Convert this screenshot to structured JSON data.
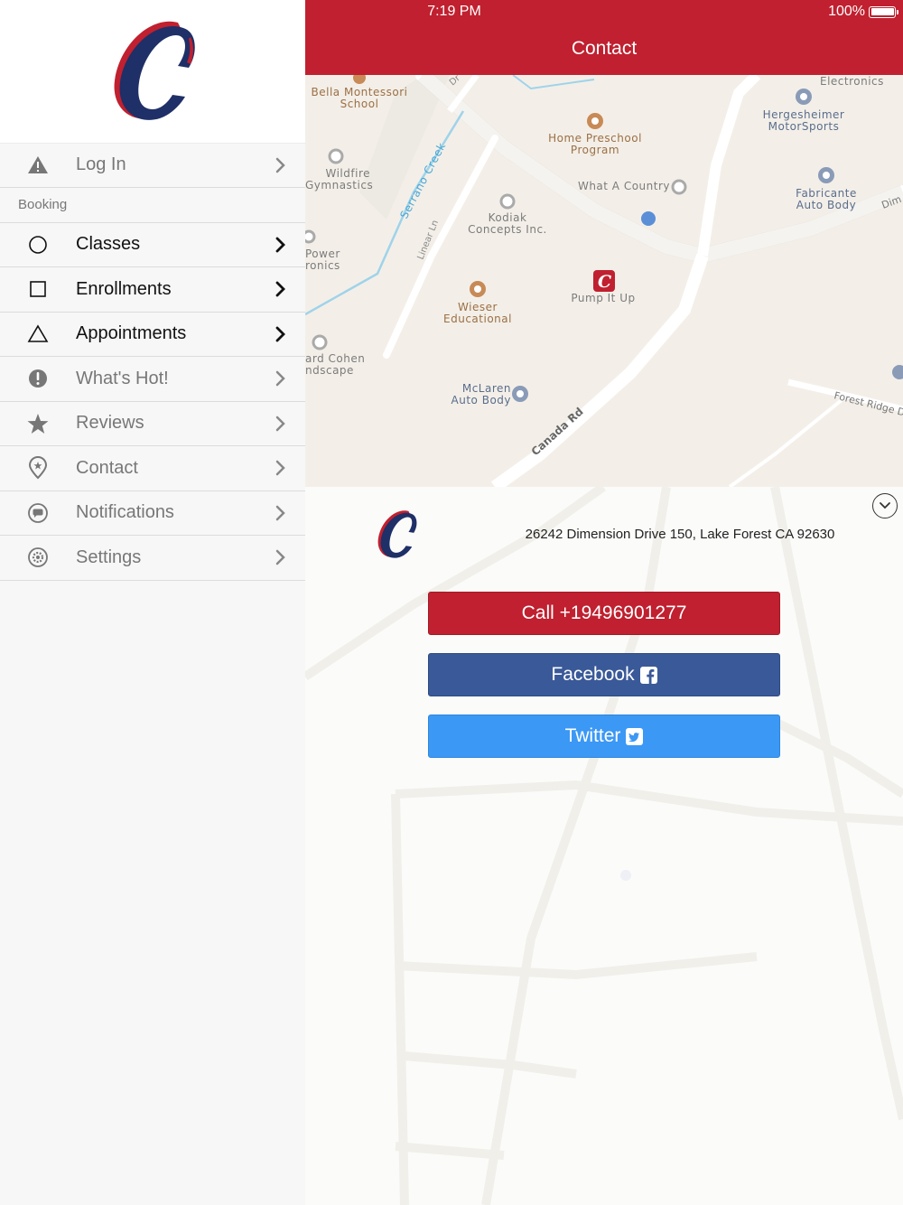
{
  "status_bar": {
    "time": "7:19 PM",
    "battery": "100%"
  },
  "header": {
    "title": "Contact"
  },
  "sidebar": {
    "items_top": [
      {
        "label": "Log In",
        "icon": "warning-icon",
        "state": "inactive"
      }
    ],
    "section_label": "Booking",
    "items": [
      {
        "label": "Classes",
        "icon": "circle-icon",
        "state": "active"
      },
      {
        "label": "Enrollments",
        "icon": "square-icon",
        "state": "active"
      },
      {
        "label": "Appointments",
        "icon": "triangle-icon",
        "state": "active"
      },
      {
        "label": "What's Hot!",
        "icon": "exclamation-icon",
        "state": "inactive"
      },
      {
        "label": "Reviews",
        "icon": "star-icon",
        "state": "inactive"
      },
      {
        "label": "Contact",
        "icon": "map-pin-icon",
        "state": "inactive"
      },
      {
        "label": "Notifications",
        "icon": "speech-bubble-icon",
        "state": "inactive"
      },
      {
        "label": "Settings",
        "icon": "gear-icon",
        "state": "inactive"
      }
    ]
  },
  "map": {
    "pois": [
      {
        "name": "Bella Montessori\nSchool",
        "style": "brown"
      },
      {
        "name": "Home Preschool\nProgram",
        "style": "brown"
      },
      {
        "name": "Electronics",
        "style": "gray"
      },
      {
        "name": "Hergesheimer\nMotorSports",
        "style": "blue"
      },
      {
        "name": "Wildfire\nGymnastics",
        "style": "gray"
      },
      {
        "name": "What A Country",
        "style": "gray"
      },
      {
        "name": "Kodiak\nConcepts Inc.",
        "style": "gray"
      },
      {
        "name": "Fabricante\nAuto Body",
        "style": "blue"
      },
      {
        "name": "Power\nronics",
        "style": "gray"
      },
      {
        "name": "Pump It Up",
        "style": "gray"
      },
      {
        "name": "Wieser\nEducational",
        "style": "brown"
      },
      {
        "name": "ard Cohen\nndscape",
        "style": "gray"
      },
      {
        "name": "McLaren\nAuto Body",
        "style": "blue"
      }
    ],
    "streets": [
      "Serrano Creek",
      "Linear Ln",
      "Canada Rd",
      "Forest Ridge D",
      "Dim",
      "Dr"
    ]
  },
  "contact": {
    "address": "26242 Dimension Drive 150, Lake Forest CA 92630",
    "call_label": "Call +19496901277",
    "facebook_label": "Facebook",
    "twitter_label": "Twitter"
  },
  "colors": {
    "brand_red": "#c0202f",
    "facebook_blue": "#3a5998",
    "twitter_blue": "#3b98f5",
    "logo_navy": "#1f2f67"
  }
}
